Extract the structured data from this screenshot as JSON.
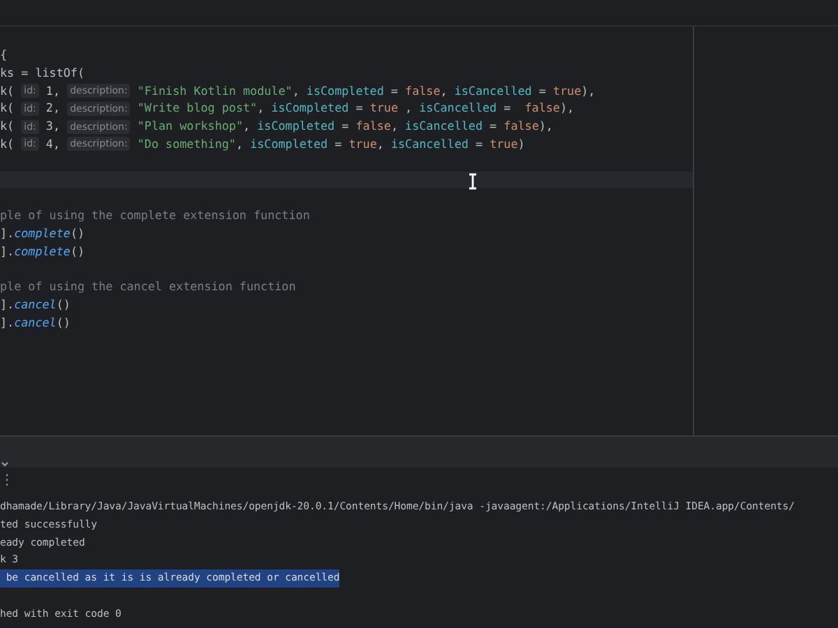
{
  "editor": {
    "lines": [
      {
        "current": false,
        "tokens": [
          {
            "kind": "plain",
            "text": "{"
          }
        ]
      },
      {
        "current": false,
        "tokens": [
          {
            "kind": "plain",
            "text": "ks = listOf("
          }
        ]
      },
      {
        "current": false,
        "tokens": [
          {
            "kind": "plain",
            "text": "k( "
          },
          {
            "kind": "hint",
            "text": "id:"
          },
          {
            "kind": "number",
            "text": " 1, "
          },
          {
            "kind": "hint",
            "text": "description:"
          },
          {
            "kind": "string",
            "text": " \"Finish Kotlin module\""
          },
          {
            "kind": "plain",
            "text": ", "
          },
          {
            "kind": "param",
            "text": "isCompleted"
          },
          {
            "kind": "plain",
            "text": " = "
          },
          {
            "kind": "keyword",
            "text": "false"
          },
          {
            "kind": "plain",
            "text": ", "
          },
          {
            "kind": "param",
            "text": "isCancelled"
          },
          {
            "kind": "plain",
            "text": " = "
          },
          {
            "kind": "keyword",
            "text": "true"
          },
          {
            "kind": "plain",
            "text": "),"
          }
        ]
      },
      {
        "current": false,
        "tokens": [
          {
            "kind": "plain",
            "text": "k( "
          },
          {
            "kind": "hint",
            "text": "id:"
          },
          {
            "kind": "number",
            "text": " 2, "
          },
          {
            "kind": "hint",
            "text": "description:"
          },
          {
            "kind": "string",
            "text": " \"Write blog post\""
          },
          {
            "kind": "plain",
            "text": ", "
          },
          {
            "kind": "param",
            "text": "isCompleted"
          },
          {
            "kind": "plain",
            "text": " = "
          },
          {
            "kind": "keyword",
            "text": "true"
          },
          {
            "kind": "plain",
            "text": " , "
          },
          {
            "kind": "param",
            "text": "isCancelled"
          },
          {
            "kind": "plain",
            "text": " =  "
          },
          {
            "kind": "keyword",
            "text": "false"
          },
          {
            "kind": "plain",
            "text": "),"
          }
        ]
      },
      {
        "current": false,
        "tokens": [
          {
            "kind": "plain",
            "text": "k( "
          },
          {
            "kind": "hint",
            "text": "id:"
          },
          {
            "kind": "number",
            "text": " 3, "
          },
          {
            "kind": "hint",
            "text": "description:"
          },
          {
            "kind": "string",
            "text": " \"Plan workshop\""
          },
          {
            "kind": "plain",
            "text": ", "
          },
          {
            "kind": "param",
            "text": "isCompleted"
          },
          {
            "kind": "plain",
            "text": " = "
          },
          {
            "kind": "keyword",
            "text": "false"
          },
          {
            "kind": "plain",
            "text": ", "
          },
          {
            "kind": "param",
            "text": "isCancelled"
          },
          {
            "kind": "plain",
            "text": " = "
          },
          {
            "kind": "keyword",
            "text": "false"
          },
          {
            "kind": "plain",
            "text": "),"
          }
        ]
      },
      {
        "current": false,
        "tokens": [
          {
            "kind": "plain",
            "text": "k( "
          },
          {
            "kind": "hint",
            "text": "id:"
          },
          {
            "kind": "number",
            "text": " 4, "
          },
          {
            "kind": "hint",
            "text": "description:"
          },
          {
            "kind": "string",
            "text": " \"Do something\""
          },
          {
            "kind": "plain",
            "text": ", "
          },
          {
            "kind": "param",
            "text": "isCompleted"
          },
          {
            "kind": "plain",
            "text": " = "
          },
          {
            "kind": "keyword",
            "text": "true"
          },
          {
            "kind": "plain",
            "text": ", "
          },
          {
            "kind": "param",
            "text": "isCancelled"
          },
          {
            "kind": "plain",
            "text": " = "
          },
          {
            "kind": "keyword",
            "text": "true"
          },
          {
            "kind": "plain",
            "text": ")"
          }
        ]
      },
      {
        "current": false
      },
      {
        "current": true
      },
      {
        "current": false
      },
      {
        "current": false,
        "tokens": [
          {
            "kind": "comment",
            "text": "ple of using the complete extension function"
          }
        ]
      },
      {
        "current": false,
        "tokens": [
          {
            "kind": "plain",
            "text": "]."
          },
          {
            "kind": "method",
            "text": "complete"
          },
          {
            "kind": "plain",
            "text": "()"
          }
        ]
      },
      {
        "current": false,
        "tokens": [
          {
            "kind": "plain",
            "text": "]."
          },
          {
            "kind": "method",
            "text": "complete"
          },
          {
            "kind": "plain",
            "text": "()"
          }
        ]
      },
      {
        "current": false
      },
      {
        "current": false,
        "tokens": [
          {
            "kind": "comment",
            "text": "ple of using the cancel extension function"
          }
        ]
      },
      {
        "current": false,
        "tokens": [
          {
            "kind": "plain",
            "text": "]."
          },
          {
            "kind": "method",
            "text": "cancel"
          },
          {
            "kind": "plain",
            "text": "()"
          }
        ]
      },
      {
        "current": false,
        "tokens": [
          {
            "kind": "plain",
            "text": "]."
          },
          {
            "kind": "method",
            "text": "cancel"
          },
          {
            "kind": "plain",
            "text": "()"
          }
        ]
      }
    ]
  },
  "console": {
    "menu_glyph": "⋮",
    "lines": [
      {
        "selected": false,
        "text": "dhamade/Library/Java/JavaVirtualMachines/openjdk-20.0.1/Contents/Home/bin/java -javaagent:/Applications/IntelliJ IDEA.app/Contents/"
      },
      {
        "selected": false,
        "text": "ted successfully"
      },
      {
        "selected": false,
        "text": "eady completed"
      },
      {
        "selected": false,
        "text": "k 3"
      },
      {
        "selected": true,
        "text": " be cancelled as it is is already completed or cancelled"
      },
      {
        "selected": false
      },
      {
        "selected": false,
        "text": "hed with exit code 0"
      }
    ]
  }
}
